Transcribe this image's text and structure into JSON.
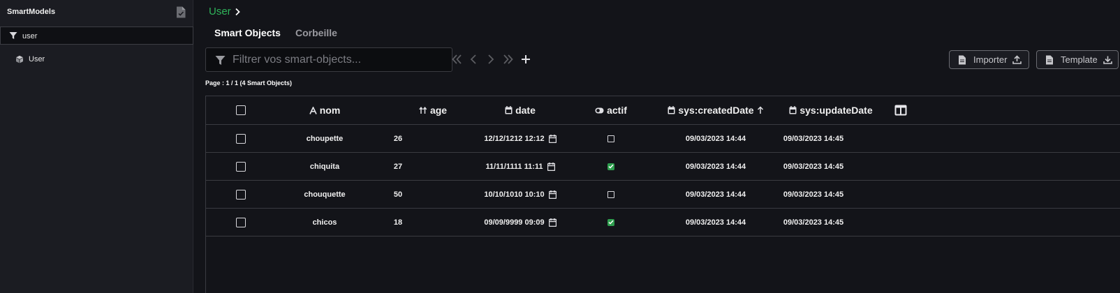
{
  "sidebar": {
    "title": "SmartModels",
    "filter_value": "user",
    "items": [
      {
        "label": "User",
        "icon": "cube-icon"
      }
    ]
  },
  "breadcrumb": {
    "link": "User"
  },
  "tabs": [
    {
      "label": "Smart Objects",
      "active": true
    },
    {
      "label": "Corbeille",
      "active": false
    }
  ],
  "search": {
    "placeholder": "Filtrer vos smart-objects...",
    "value": ""
  },
  "buttons": {
    "import_label": "Importer",
    "template_label": "Template"
  },
  "page_info": "Page : 1 / 1 (4 Smart Objects)",
  "table": {
    "columns": [
      {
        "label": "nom",
        "icon": "text-type-icon"
      },
      {
        "label": "age",
        "icon": "number-sort-icon"
      },
      {
        "label": "date",
        "icon": "calendar-icon"
      },
      {
        "label": "actif",
        "icon": "toggle-icon"
      },
      {
        "label": "sys:createdDate",
        "icon": "calendar-icon",
        "sort": "asc"
      },
      {
        "label": "sys:updateDate",
        "icon": "calendar-icon"
      }
    ],
    "rows": [
      {
        "nom": "choupette",
        "age": "26",
        "date": "12/12/1212  12:12",
        "actif": false,
        "created": "09/03/2023 14:44",
        "updated": "09/03/2023 14:45"
      },
      {
        "nom": "chiquita",
        "age": "27",
        "date": "11/11/1111  11:11",
        "actif": true,
        "created": "09/03/2023 14:44",
        "updated": "09/03/2023 14:45"
      },
      {
        "nom": "chouquette",
        "age": "50",
        "date": "10/10/1010  10:10",
        "actif": false,
        "created": "09/03/2023 14:44",
        "updated": "09/03/2023 14:45"
      },
      {
        "nom": "chicos",
        "age": "18",
        "date": "09/09/9999  09:09",
        "actif": true,
        "created": "09/03/2023 14:44",
        "updated": "09/03/2023 14:45"
      }
    ]
  },
  "colors": {
    "accent_green": "#2fb45a",
    "checked_green": "#2e9e4e",
    "background": "#131419",
    "sidebar": "#1b1c22"
  }
}
